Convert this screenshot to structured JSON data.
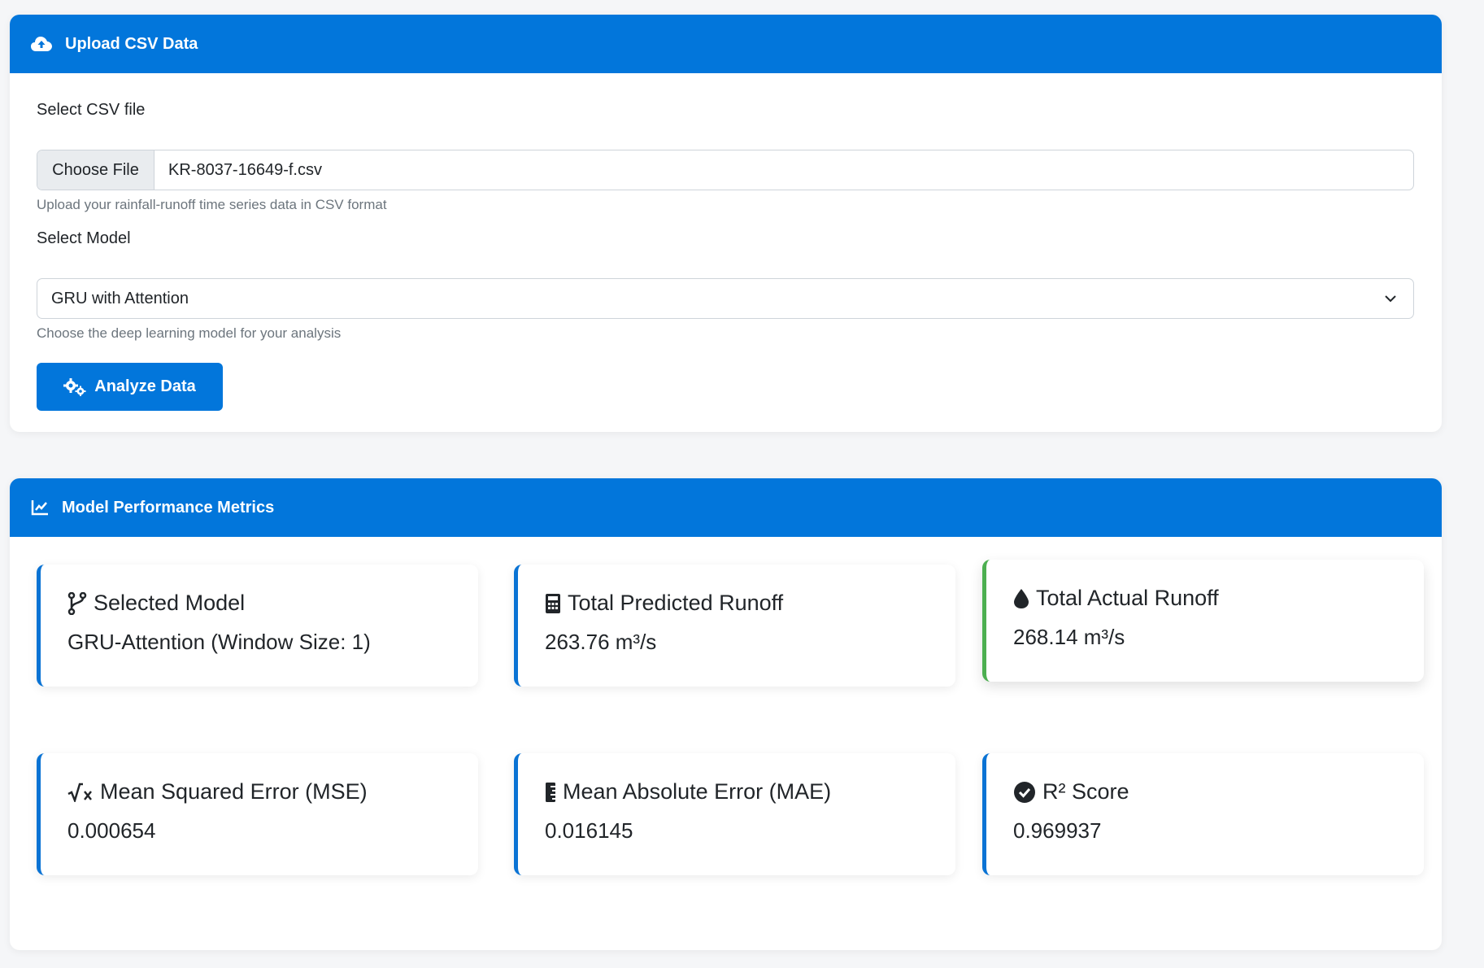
{
  "upload": {
    "title": "Upload CSV Data",
    "file_label": "Select CSV file",
    "choose_file": "Choose File",
    "file_name": "KR-8037-16649-f.csv",
    "file_help": "Upload your rainfall-runoff time series data in CSV format",
    "model_label": "Select Model",
    "model_selected": "GRU with Attention",
    "model_help": "Choose the deep learning model for your analysis",
    "analyze_label": "Analyze Data"
  },
  "metrics": {
    "title": "Model Performance Metrics",
    "cards": [
      {
        "title": "Selected Model",
        "value": "GRU-Attention (Window Size: 1)",
        "icon": "code-branch-icon"
      },
      {
        "title": "Total Predicted Runoff",
        "value": "263.76 m³/s",
        "icon": "calculator-icon"
      },
      {
        "title": "Total Actual Runoff",
        "value": "268.14 m³/s",
        "icon": "droplet-icon"
      },
      {
        "title": "Mean Squared Error (MSE)",
        "value": "0.000654",
        "icon": "square-root-icon"
      },
      {
        "title": "Mean Absolute Error (MAE)",
        "value": "0.016145",
        "icon": "ruler-icon"
      },
      {
        "title": "R² Score",
        "value": "0.969937",
        "icon": "check-circle-icon"
      }
    ]
  },
  "colors": {
    "primary": "#0276db",
    "accent_green": "#4caf50",
    "card_border": "#0a73d4"
  }
}
